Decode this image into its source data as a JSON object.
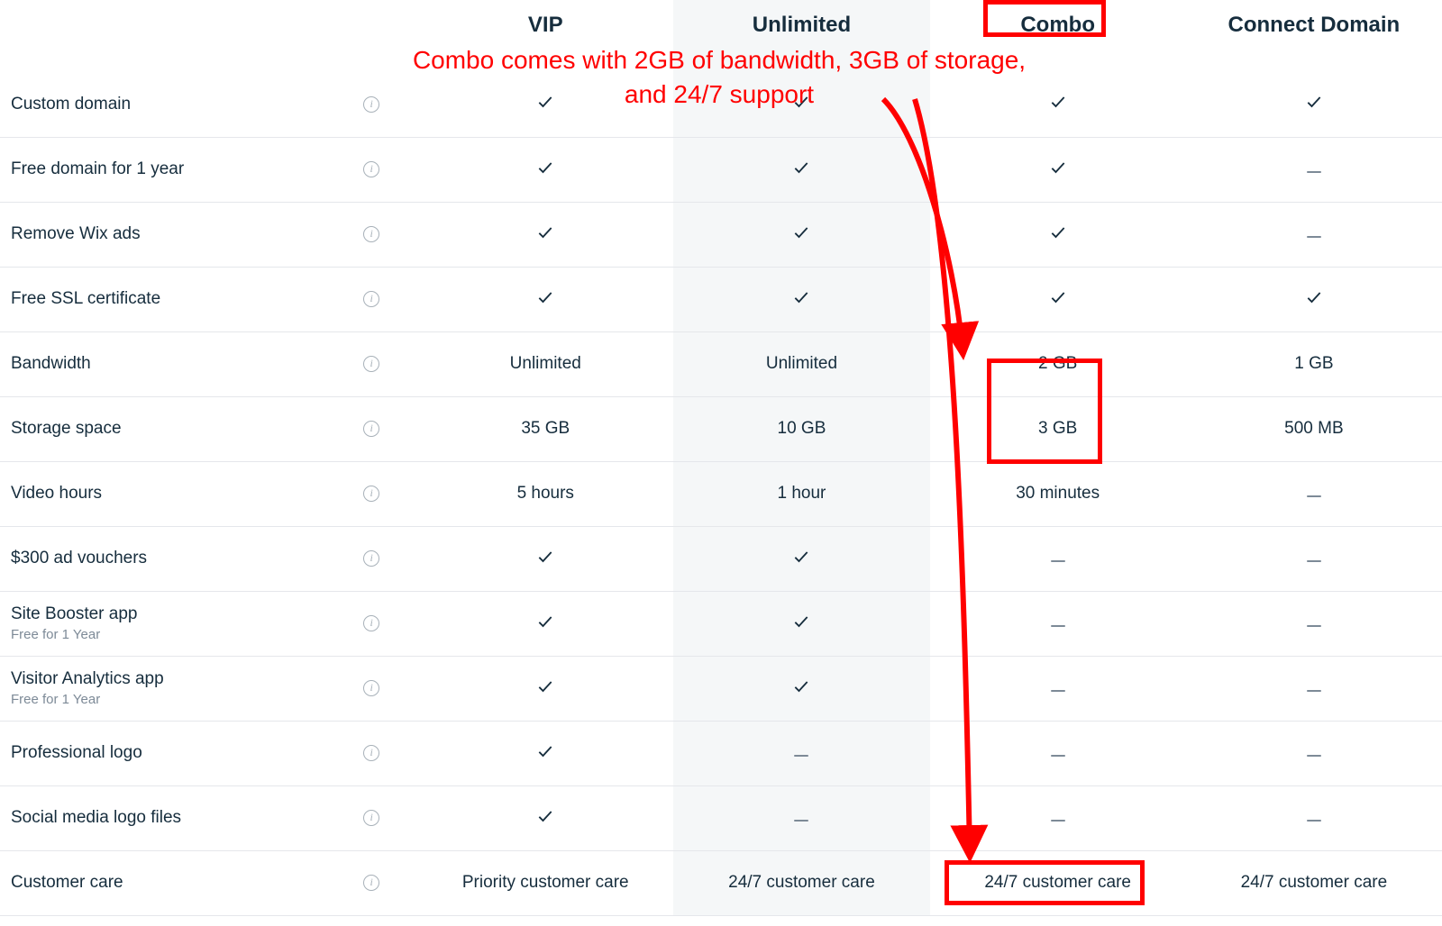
{
  "annotation": {
    "text": "Combo comes with 2GB of bandwidth, 3GB of storage,\nand 24/7 support"
  },
  "plans": {
    "vip": "VIP",
    "unlimited": "Unlimited",
    "combo": "Combo",
    "connect": "Connect Domain"
  },
  "features": [
    {
      "label": "Custom domain",
      "sublabel": null,
      "vip": "check",
      "unlimited": "check",
      "combo": "check",
      "connect": "check"
    },
    {
      "label": "Free domain for 1 year",
      "sublabel": null,
      "vip": "check",
      "unlimited": "check",
      "combo": "check",
      "connect": "dash"
    },
    {
      "label": "Remove Wix ads",
      "sublabel": null,
      "vip": "check",
      "unlimited": "check",
      "combo": "check",
      "connect": "dash"
    },
    {
      "label": "Free SSL certificate",
      "sublabel": null,
      "vip": "check",
      "unlimited": "check",
      "combo": "check",
      "connect": "check"
    },
    {
      "label": "Bandwidth",
      "sublabel": null,
      "vip": "Unlimited",
      "unlimited": "Unlimited",
      "combo": "2 GB",
      "connect": "1 GB"
    },
    {
      "label": "Storage space",
      "sublabel": null,
      "vip": "35 GB",
      "unlimited": "10 GB",
      "combo": "3 GB",
      "connect": "500 MB"
    },
    {
      "label": "Video hours",
      "sublabel": null,
      "vip": "5 hours",
      "unlimited": "1 hour",
      "combo": "30 minutes",
      "connect": "dash"
    },
    {
      "label": "$300 ad vouchers",
      "sublabel": null,
      "vip": "check",
      "unlimited": "check",
      "combo": "dash",
      "connect": "dash"
    },
    {
      "label": "Site Booster app",
      "sublabel": "Free for 1 Year",
      "vip": "check",
      "unlimited": "check",
      "combo": "dash",
      "connect": "dash"
    },
    {
      "label": "Visitor Analytics app",
      "sublabel": "Free for 1 Year",
      "vip": "check",
      "unlimited": "check",
      "combo": "dash",
      "connect": "dash"
    },
    {
      "label": "Professional logo",
      "sublabel": null,
      "vip": "check",
      "unlimited": "dash",
      "combo": "dash",
      "connect": "dash"
    },
    {
      "label": "Social media logo files",
      "sublabel": null,
      "vip": "check",
      "unlimited": "dash",
      "combo": "dash",
      "connect": "dash"
    },
    {
      "label": "Customer care",
      "sublabel": null,
      "vip": "Priority customer care",
      "unlimited": "24/7 customer care",
      "combo": "24/7 customer care",
      "connect": "24/7 customer care"
    }
  ]
}
